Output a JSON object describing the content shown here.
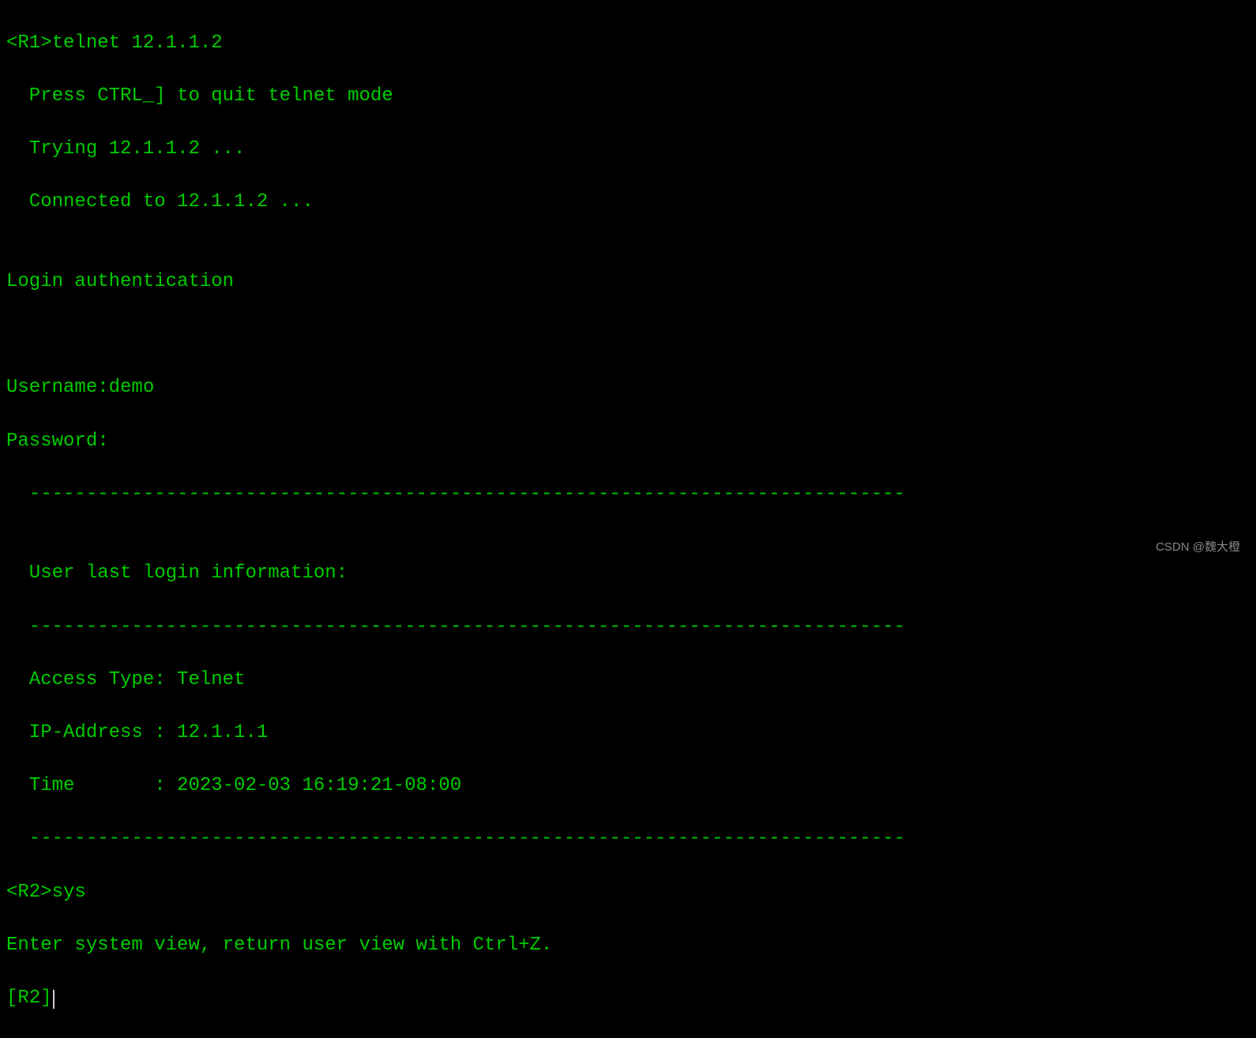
{
  "terminal": {
    "lines": {
      "l0": "<R1>telnet 12.1.1.2",
      "l1": "  Press CTRL_] to quit telnet mode",
      "l2": "  Trying 12.1.1.2 ...",
      "l3": "  Connected to 12.1.1.2 ...",
      "l4": "",
      "l5": "Login authentication",
      "l6": "",
      "l7": "",
      "l8": "Username:demo",
      "l9": "Password:",
      "l10": "  -----------------------------------------------------------------------------",
      "l11": "",
      "l12": "  User last login information:",
      "l13": "  -----------------------------------------------------------------------------",
      "l14": "  Access Type: Telnet",
      "l15": "  IP-Address : 12.1.1.1",
      "l16": "  Time       : 2023-02-03 16:19:21-08:00",
      "l17": "  -----------------------------------------------------------------------------",
      "l18": "<R2>sys",
      "l19": "Enter system view, return user view with Ctrl+Z.",
      "l20": "[R2]"
    }
  },
  "session": {
    "source_router": "R1",
    "target_router": "R2",
    "command1": "telnet 12.1.1.2",
    "target_ip": "12.1.1.2",
    "username": "demo",
    "access_type": "Telnet",
    "source_ip": "12.1.1.1",
    "last_login_time": "2023-02-03 16:19:21-08:00",
    "command2": "sys",
    "current_prompt": "[R2]"
  },
  "watermark": {
    "text": "CSDN @魏大橙"
  }
}
